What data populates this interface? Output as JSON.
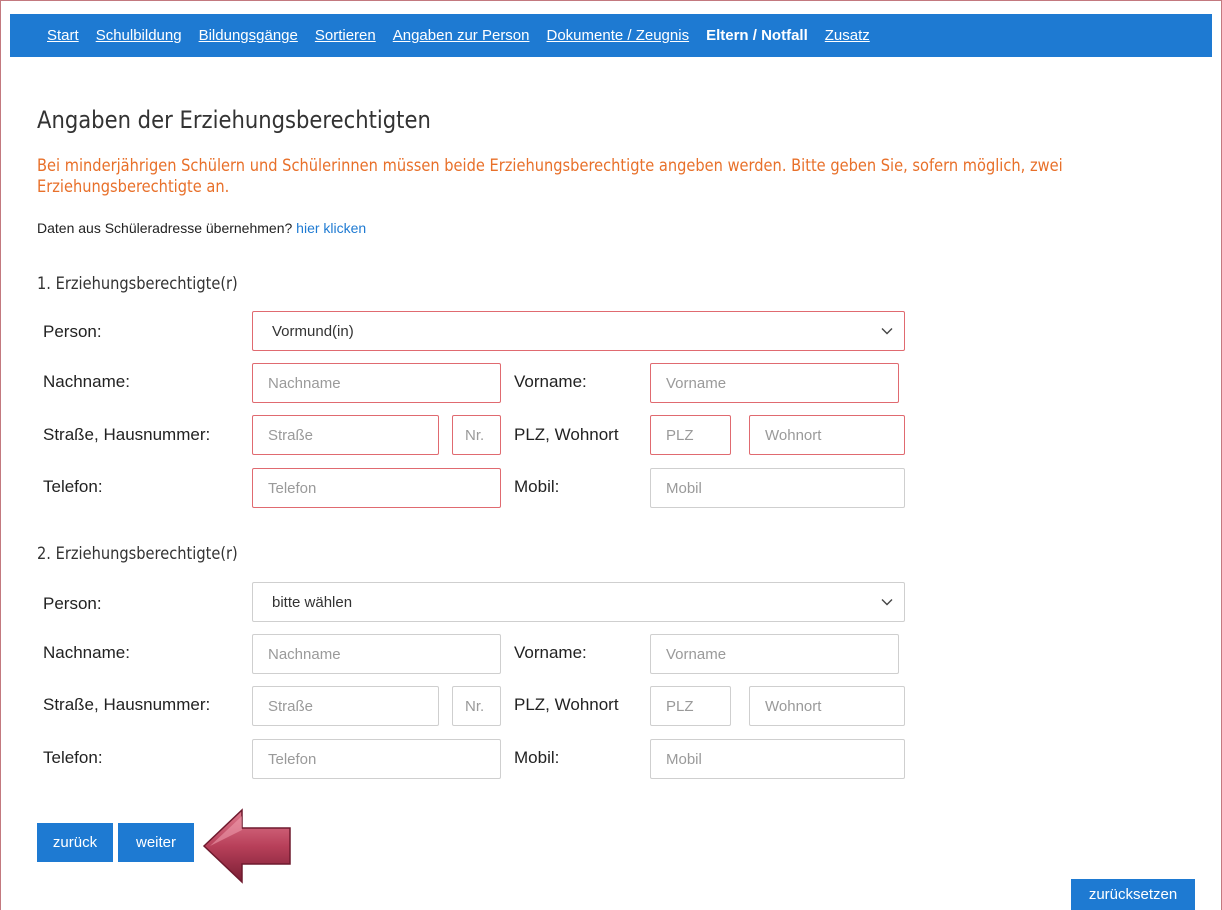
{
  "nav": {
    "items": [
      {
        "label": "Start",
        "active": false
      },
      {
        "label": "Schulbildung",
        "active": false
      },
      {
        "label": "Bildungsgänge",
        "active": false
      },
      {
        "label": "Sortieren",
        "active": false
      },
      {
        "label": "Angaben zur Person",
        "active": false
      },
      {
        "label": "Dokumente / Zeugnis",
        "active": false
      },
      {
        "label": "Eltern / Notfall",
        "active": true
      },
      {
        "label": "Zusatz",
        "active": false
      }
    ]
  },
  "page": {
    "title": "Angaben der Erziehungsberechtigten",
    "warning": "Bei minderjährigen Schülern und Schülerinnen müssen beide Erziehungsberechtigte angeben werden. Bitte geben Sie, sofern möglich, zwei Erziehungsberechtigte an.",
    "copy_prompt": "Daten aus Schüleradresse übernehmen?",
    "copy_link": "hier klicken"
  },
  "labels": {
    "person": "Person:",
    "nachname": "Nachname:",
    "vorname": "Vorname:",
    "strasse": "Straße, Hausnummer:",
    "plz_ort": "PLZ, Wohnort",
    "telefon": "Telefon:",
    "mobil": "Mobil:"
  },
  "placeholders": {
    "nachname": "Nachname",
    "vorname": "Vorname",
    "strasse": "Straße",
    "nr": "Nr.",
    "plz": "PLZ",
    "wohnort": "Wohnort",
    "telefon": "Telefon",
    "mobil": "Mobil"
  },
  "guardian1": {
    "title": "1. Erziehungsberechtigte(r)",
    "person_value": "Vormund(in)",
    "required_error": true
  },
  "guardian2": {
    "title": "2. Erziehungsberechtigte(r)",
    "person_value": "bitte wählen",
    "required_error": false
  },
  "buttons": {
    "back": "zurück",
    "next": "weiter",
    "reset": "zurücksetzen"
  },
  "colors": {
    "primary": "#1e7ad2",
    "warning": "#e8702a",
    "error_border": "#e06a70",
    "arrow": "#b8405a"
  },
  "annotation": {
    "arrow_icon": "left-arrow-icon"
  }
}
